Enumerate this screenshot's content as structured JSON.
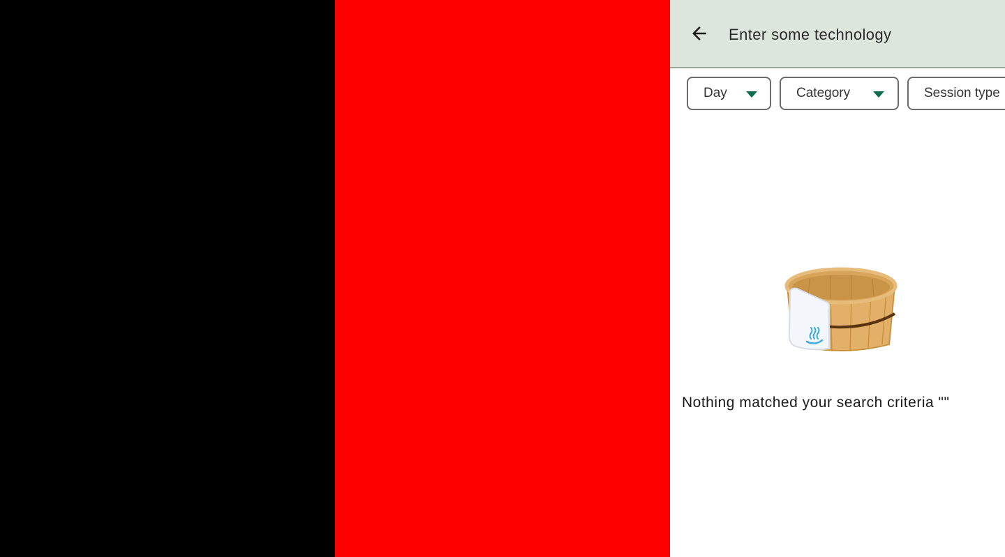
{
  "colors": {
    "left_panel": "#000000",
    "middle_panel": "#ff0000",
    "topbar_bg": "#dde6dd",
    "chip_caret": "#0a6a4a"
  },
  "search": {
    "placeholder": "Enter some technology",
    "value": "",
    "back_icon": "arrow-back-icon"
  },
  "filters": [
    {
      "label": "Day",
      "icon": "dropdown-caret-icon"
    },
    {
      "label": "Category",
      "icon": "dropdown-caret-icon"
    },
    {
      "label": "Session type",
      "icon": "dropdown-caret-icon"
    }
  ],
  "empty_state": {
    "illustration": "wooden-onsen-bucket-with-towel",
    "message": "Nothing matched your search criteria \"\""
  }
}
